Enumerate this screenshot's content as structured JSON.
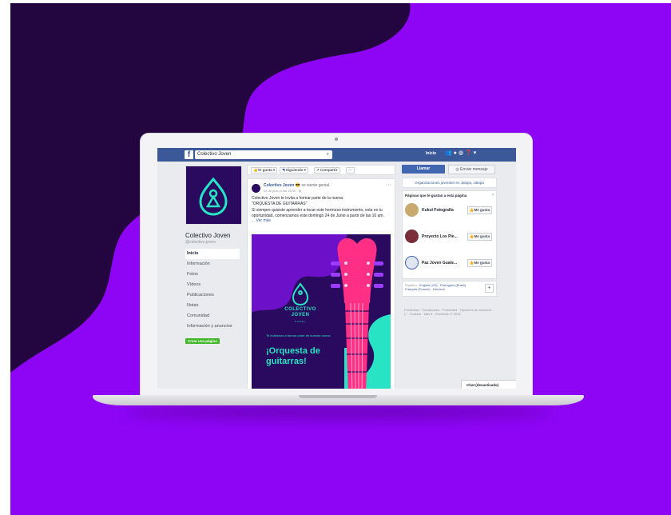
{
  "colors": {
    "background": "#8e05f6",
    "blob": "#23053f",
    "fb_blue": "#3b5998",
    "accent_teal": "#28e4c4",
    "accent_pink": "#ff2f86"
  },
  "topbar": {
    "search_value": "Colectivo Joven",
    "home": "Inicio",
    "icons": [
      "friends-icon",
      "messages-icon",
      "globe-icon",
      "help-icon"
    ]
  },
  "left": {
    "page_name": "Colectivo Joven",
    "handle": "@colectivo.joven",
    "menu": [
      "Inicio",
      "Información",
      "Fotos",
      "Vídeos",
      "Publicaciones",
      "Notas",
      "Comunidad",
      "Información y anuncios"
    ],
    "create_page": "Crear una página"
  },
  "actions": {
    "like": "Te gusta ▾",
    "follow": "Siguiendo ▾",
    "share": "Compartir",
    "more": "···"
  },
  "post": {
    "author": "Colectivo Joven",
    "feeling": "se siente genial.",
    "date": "22 de junio a las 16:30 · ",
    "line1": "Colectivo Joven te invita a formar parte de la nueva:",
    "line2": "\"ORQUESTA DE GUITARRAS\"",
    "line3": "Si siempre quisiste aprender a tocar este hermoso instrumento, esta es tu oportunidad, comenzamos este domingo 24 de Junio a partir de las 10 am.",
    "see_more": "... Ver más",
    "poster": {
      "name_line1": "COLECTIVO",
      "name_line2": "JOVEN",
      "sub": "XAPAL",
      "invite": "Te invitamos a formar parte de nuestra nueva",
      "title": "¡Orquesta de guitarras!"
    }
  },
  "right": {
    "call": "Llamar",
    "message": "Enviar mensaje",
    "org": "Organizaciones juveniles en Jalapa, Jalapa",
    "likes_head": "Páginas que le gustan a esta página",
    "liked_pages": [
      {
        "name": "Kukul Fotografía",
        "button": "Me gusta"
      },
      {
        "name": "Proyecto Los Pie...",
        "button": "Me gusta"
      },
      {
        "name": "Paz Joven Guate...",
        "button": "Me gusta"
      }
    ],
    "languages": {
      "current": "Español · ",
      "en": "English (US)",
      "sep": " · ",
      "pt": "Português (Brasil)",
      "line2": "Français (France) · Deutsch"
    },
    "plus": "+",
    "footer": "Privacidad · Condiciones · Publicidad · Opciones de anuncios ▷ · Cookies · Más ▾ · Facebook © 2018"
  },
  "chat": "Chat (desactivado)"
}
